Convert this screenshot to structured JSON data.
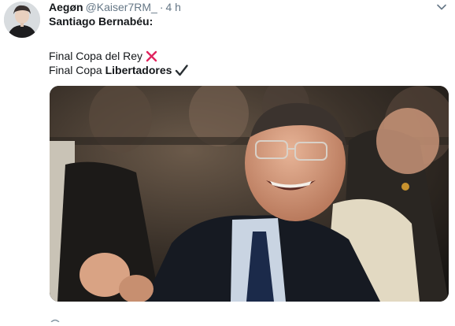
{
  "tweet": {
    "author": {
      "name": "Aegøn",
      "handle": "@Kaiser7RM_",
      "time": "4 h",
      "separator": "·"
    },
    "lines": {
      "line1": "Santiago Bernabéu:",
      "line2": "Final Copa del Rey",
      "line3_prefix": "Final Copa ",
      "line3_bold": "Libertadores"
    },
    "icons": {
      "cross": "cross-mark-icon",
      "check": "check-mark-icon",
      "menu": "chevron-down-icon"
    },
    "colors": {
      "cross": "#e0245e",
      "check": "#292f33",
      "muted": "#657786"
    }
  }
}
